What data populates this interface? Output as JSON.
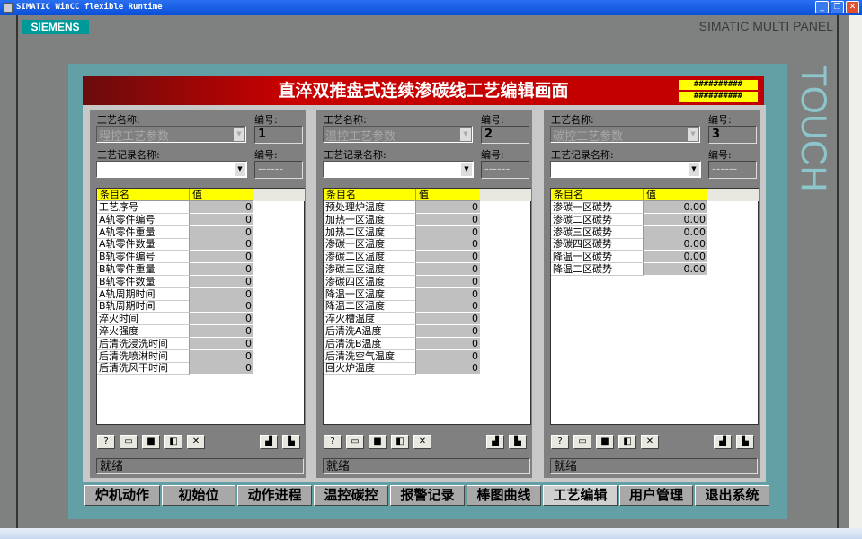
{
  "window": {
    "title": "SIMATIC WinCC flexible Runtime"
  },
  "brand": {
    "logo": "SIEMENS",
    "panel_label": "SIMATIC MULTI PANEL",
    "touch_label": "TOUCH",
    "logo_color": "#009999"
  },
  "header": {
    "title": "直淬双推盘式连续渗碳线工艺编辑画面",
    "hash1": "##########",
    "hash2": "##########"
  },
  "panels": [
    {
      "name_label": "工艺名称:",
      "name_value": "程控工艺参数",
      "no_label": "编号:",
      "no_value": "1",
      "rec_label": "工艺记录名称:",
      "rec_value": "",
      "rec_no_label": "编号:",
      "rec_no_value": "------",
      "col_name": "条目名",
      "col_value": "值",
      "status": "就绪",
      "rows": [
        [
          "工艺序号",
          "0"
        ],
        [
          "A轨零件编号",
          "0"
        ],
        [
          "A轨零件重量",
          "0"
        ],
        [
          "A轨零件数量",
          "0"
        ],
        [
          "B轨零件编号",
          "0"
        ],
        [
          " B轨零件重量",
          "0"
        ],
        [
          " B轨零件数量",
          "0"
        ],
        [
          "A轨周期时间",
          "0"
        ],
        [
          "B轨周期时间",
          "0"
        ],
        [
          "淬火时间",
          "0"
        ],
        [
          "淬火强度",
          "0"
        ],
        [
          "后清洗浸洗时间",
          "0"
        ],
        [
          "后清洗喷淋时间",
          "0"
        ],
        [
          "后清洗风干时间",
          "0"
        ]
      ]
    },
    {
      "name_label": "工艺名称:",
      "name_value": "温控工艺参数",
      "no_label": "编号:",
      "no_value": "2",
      "rec_label": "工艺记录名称:",
      "rec_value": "",
      "rec_no_label": "编号:",
      "rec_no_value": "------",
      "col_name": "条目名",
      "col_value": "值",
      "status": "就绪",
      "rows": [
        [
          "预处理炉温度",
          "0"
        ],
        [
          "加热一区温度",
          "0"
        ],
        [
          "加热二区温度",
          "0"
        ],
        [
          "渗碳一区温度",
          "0"
        ],
        [
          "渗碳二区温度",
          "0"
        ],
        [
          "渗碳三区温度",
          "0"
        ],
        [
          "渗碳四区温度",
          "0"
        ],
        [
          "降温一区温度",
          "0"
        ],
        [
          "降温二区温度",
          "0"
        ],
        [
          "淬火槽温度",
          "0"
        ],
        [
          "后清洗A温度",
          "0"
        ],
        [
          "后清洗B温度",
          "0"
        ],
        [
          "后清洗空气温度",
          "0"
        ],
        [
          "回火炉温度",
          "0"
        ]
      ]
    },
    {
      "name_label": "工艺名称:",
      "name_value": "碳控工艺参数",
      "no_label": "编号:",
      "no_value": "3",
      "rec_label": "工艺记录名称:",
      "rec_value": "",
      "rec_no_label": "编号:",
      "rec_no_value": "------",
      "col_name": "条目名",
      "col_value": "值",
      "status": "就绪",
      "rows": [
        [
          "渗碳一区碳势",
          "0.00"
        ],
        [
          "渗碳二区碳势",
          "0.00"
        ],
        [
          "渗碳三区碳势",
          "0.00"
        ],
        [
          "渗碳四区碳势",
          "0.00"
        ],
        [
          "降温一区碳势",
          "0.00"
        ],
        [
          "降温二区碳势",
          "0.00"
        ]
      ]
    }
  ],
  "toolbar_icons": [
    "help-icon",
    "open-icon",
    "save-icon",
    "save-as-icon",
    "delete-icon",
    "export-icon",
    "import-icon"
  ],
  "tabs": [
    "炉机动作",
    "初始位",
    "动作进程",
    "温控碳控",
    "报警记录",
    "棒图曲线",
    "工艺编辑",
    "用户管理",
    "退出系统"
  ],
  "active_tab": "工艺编辑"
}
